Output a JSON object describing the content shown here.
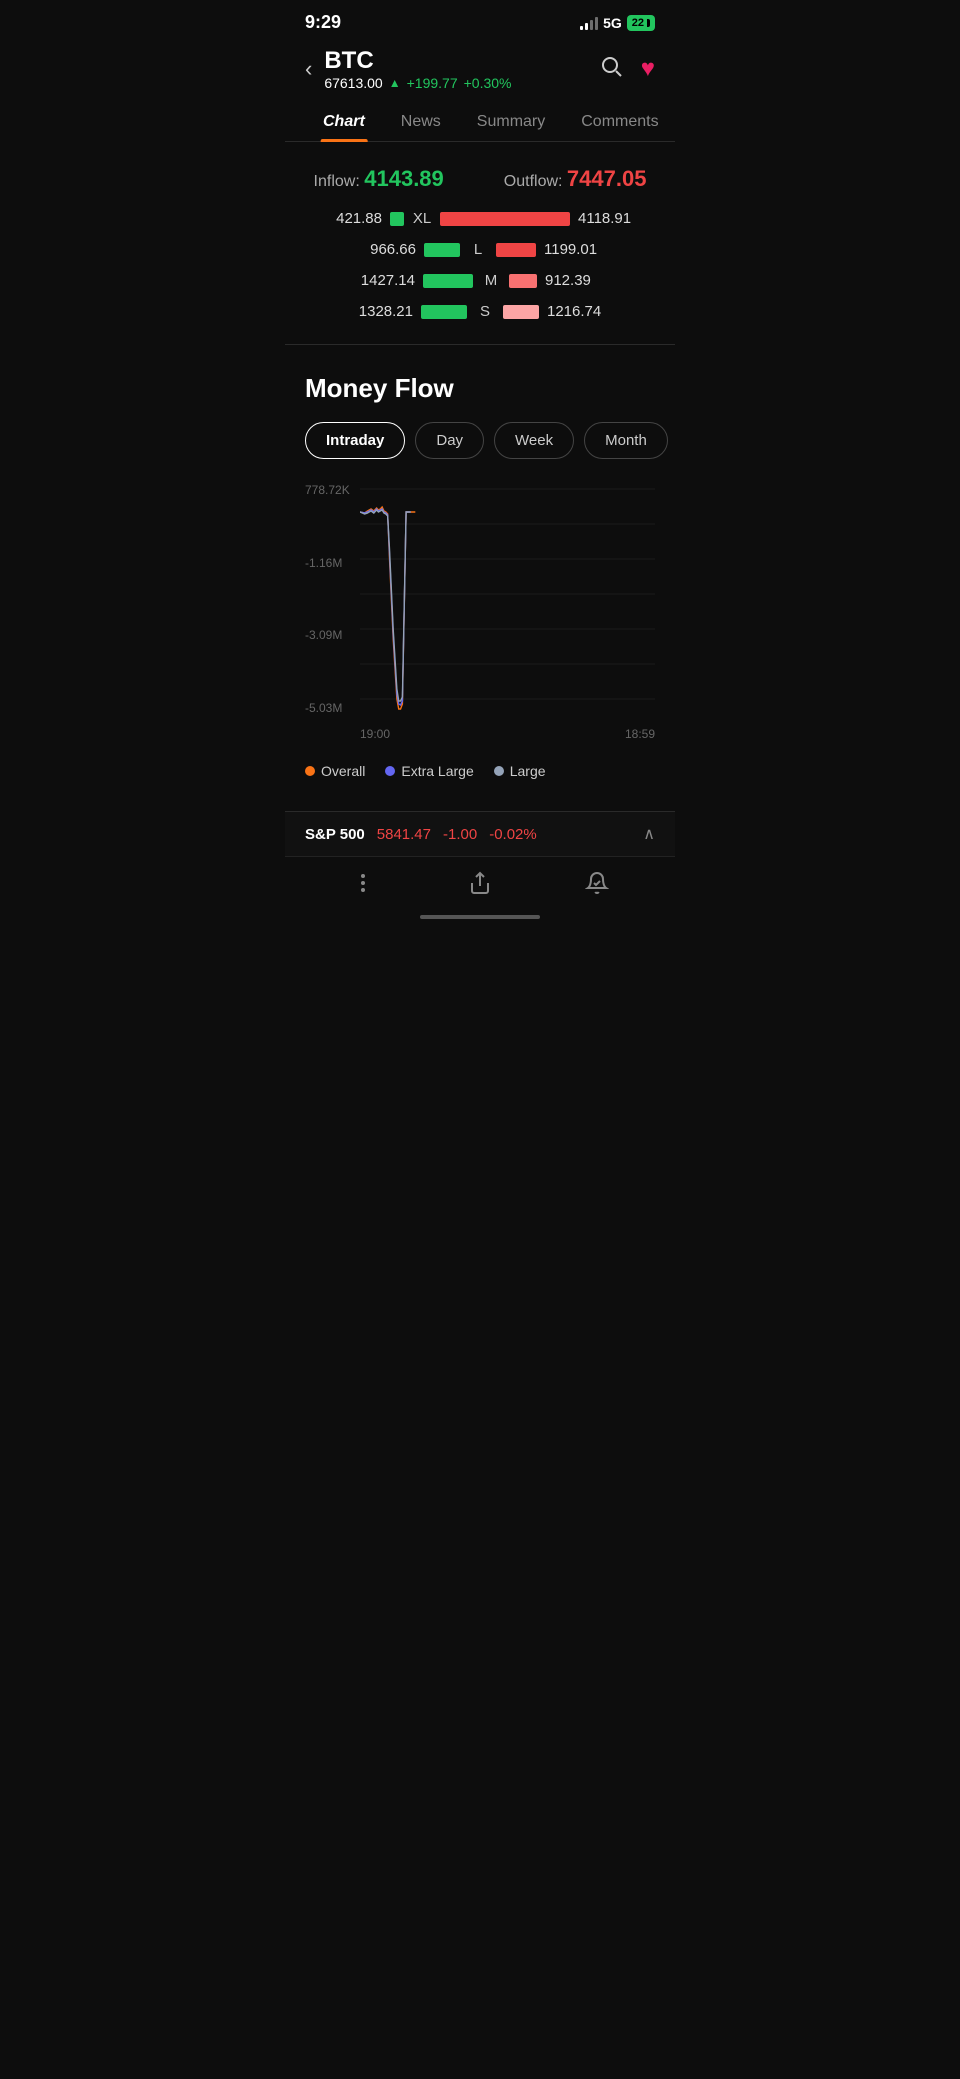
{
  "statusBar": {
    "time": "9:29",
    "fiveG": "5G",
    "battery": "22"
  },
  "header": {
    "back": "‹",
    "symbol": "BTC",
    "price": "67613.00",
    "upArrow": "▲",
    "change": "+199.77",
    "changePct": "+0.30%",
    "searchIcon": "○",
    "heartIcon": "♥"
  },
  "tabs": [
    {
      "label": "Chart",
      "active": true
    },
    {
      "label": "News",
      "active": false
    },
    {
      "label": "Summary",
      "active": false
    },
    {
      "label": "Comments",
      "active": false
    }
  ],
  "flowSection": {
    "inflowLabel": "Inflow:",
    "inflowValue": "4143.89",
    "outflowLabel": "Outflow:",
    "outflowValue": "7447.05",
    "bars": [
      {
        "leftValue": "421.88",
        "sizeLabel": "XL",
        "rightValue": "4118.91",
        "greenWidth": 14,
        "redWidth": 130,
        "redClass": ""
      },
      {
        "leftValue": "966.66",
        "sizeLabel": "L",
        "rightValue": "1199.01",
        "greenWidth": 36,
        "redWidth": 40,
        "redClass": ""
      },
      {
        "leftValue": "1427.14",
        "sizeLabel": "M",
        "rightValue": "912.39",
        "greenWidth": 50,
        "redWidth": 28,
        "redClass": "medium"
      },
      {
        "leftValue": "1328.21",
        "sizeLabel": "S",
        "rightValue": "1216.74",
        "greenWidth": 46,
        "redWidth": 36,
        "redClass": "small"
      }
    ]
  },
  "moneyFlow": {
    "title": "Money Flow",
    "periods": [
      {
        "label": "Intraday",
        "active": true
      },
      {
        "label": "Day",
        "active": false
      },
      {
        "label": "Week",
        "active": false
      },
      {
        "label": "Month",
        "active": false
      }
    ],
    "yLabels": [
      "778.72K",
      "",
      "-1.16M",
      "",
      "-3.09M",
      "",
      "-5.03M"
    ],
    "xLabels": [
      "19:00",
      "18:59"
    ],
    "legend": [
      {
        "label": "Overall",
        "color": "#f97316"
      },
      {
        "label": "Extra Large",
        "color": "#6366f1"
      },
      {
        "label": "Large",
        "color": "#64748b"
      }
    ]
  },
  "bottomTicker": {
    "name": "S&P 500",
    "price": "5841.47",
    "change": "-1.00",
    "changePct": "-0.02%"
  },
  "bottomNav": [
    {
      "label": "more",
      "icon": "⋮"
    },
    {
      "label": "share",
      "icon": "⬡"
    },
    {
      "label": "alert",
      "icon": "🔔"
    }
  ]
}
